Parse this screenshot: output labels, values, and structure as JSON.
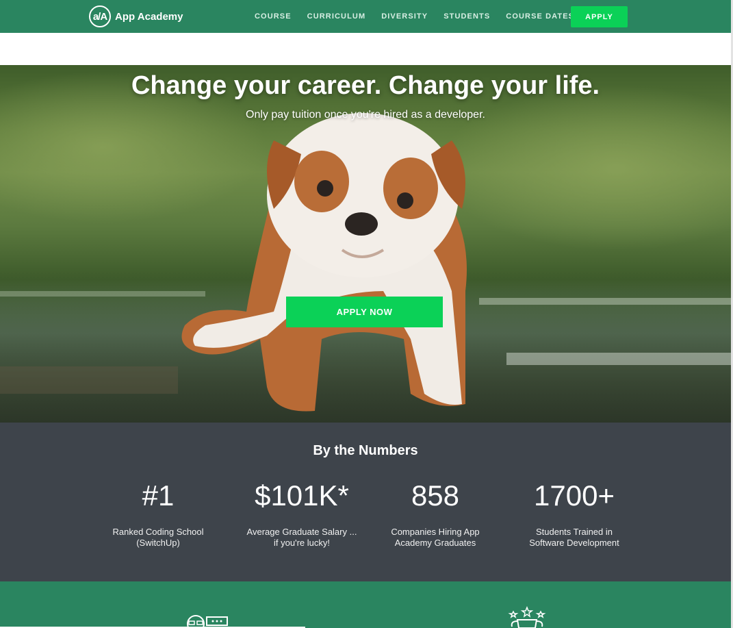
{
  "nav": {
    "logo_mark": "a/A",
    "logo_text": "App Academy",
    "links": [
      "COURSE",
      "CURRICULUM",
      "DIVERSITY",
      "STUDENTS",
      "COURSE DATES"
    ],
    "apply_label": "APPLY",
    "bar_color": "#2a8560",
    "accent_color": "#0bd157"
  },
  "hero": {
    "title": "Change your career. Change your life.",
    "subtitle": "Only pay tuition once you're hired as a developer.",
    "cta_label": "APPLY NOW"
  },
  "numbers": {
    "title": "By the Numbers",
    "stats": [
      {
        "value": "#1",
        "label_line1": "Ranked Coding School",
        "label_line2": "(SwitchUp)"
      },
      {
        "value": "$101K*",
        "label_line1": "Average Graduate Salary ...",
        "label_line2": "if you're lucky!"
      },
      {
        "value": "858",
        "label_line1": "Companies Hiring App",
        "label_line2": "Academy Graduates"
      },
      {
        "value": "1700+",
        "label_line1": "Students Trained in",
        "label_line2": "Software Development"
      }
    ],
    "background_color": "#3e444b"
  },
  "bottom_icons": [
    "developer-icon",
    "trophy-stars-icon"
  ]
}
